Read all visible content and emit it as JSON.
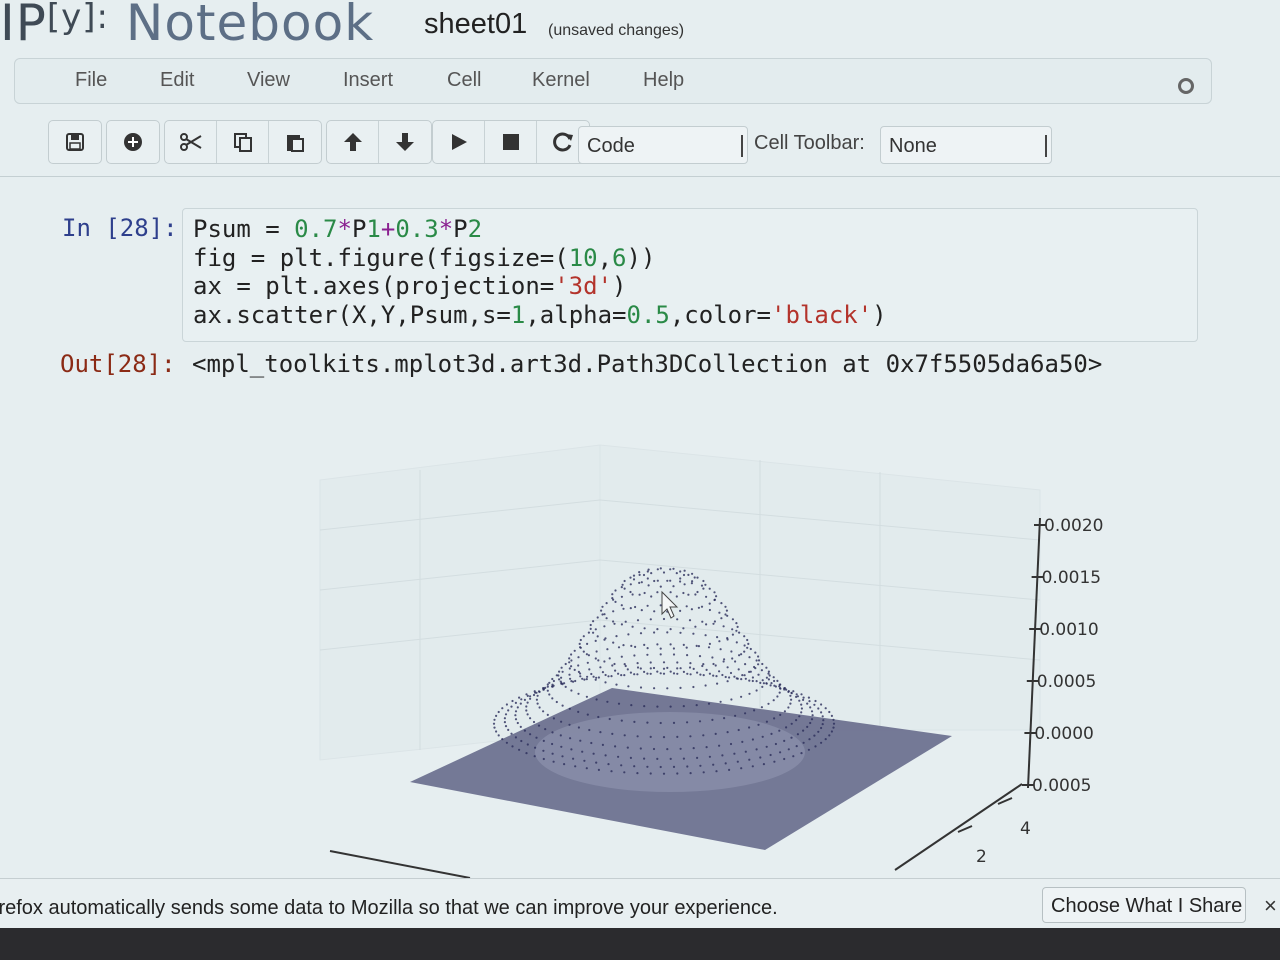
{
  "header": {
    "logo_prefix": "IP",
    "logo_bracket": "[y]:",
    "logo_word": "Notebook",
    "notebook_name": "sheet01",
    "save_status": "(unsaved changes)"
  },
  "menubar": {
    "items": [
      "File",
      "Edit",
      "View",
      "Insert",
      "Cell",
      "Kernel",
      "Help"
    ]
  },
  "toolbar": {
    "cell_type": "Code",
    "cell_toolbar_label": "Cell Toolbar:",
    "cell_toolbar_value": "None"
  },
  "cell": {
    "in_prompt": "In [28]:",
    "out_prompt": "Out[28]:",
    "code_lines": [
      "Psum = 0.7*P1+0.3*P2",
      "fig = plt.figure(figsize=(10,6))",
      "ax = plt.axes(projection='3d')",
      "ax.scatter(X,Y,Psum,s=1,alpha=0.5,color='black')"
    ],
    "output_text": "<mpl_toolkits.mplot3d.art3d.Path3DCollection at 0x7f5505da6a50>"
  },
  "chart_data": {
    "type": "scatter",
    "projection": "3d",
    "color": "#2a2d5a",
    "alpha": 0.5,
    "z_ticks": [
      "0.0020",
      "0.0015",
      "0.0010",
      "0.0005",
      "0.0000",
      "0.0005"
    ],
    "y_ticks": [
      "4",
      "2"
    ],
    "zlim": [
      -0.0005,
      0.002
    ],
    "peak_z": 0.0019,
    "grid": true
  },
  "notification": {
    "message": "irefox automatically sends some data to Mozilla so that we can improve your experience.",
    "button": "Choose What I Share",
    "close": "×"
  },
  "colors": {
    "background": "#e6eef0",
    "prompt_in": "#2e3f8c",
    "prompt_out": "#8b2a15"
  }
}
